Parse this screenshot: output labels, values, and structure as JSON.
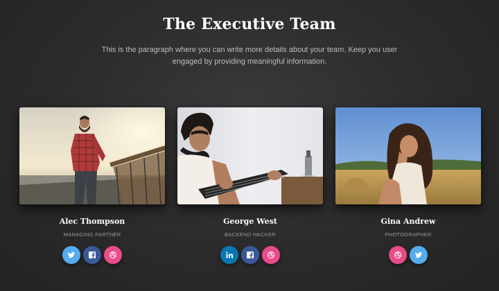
{
  "header": {
    "title": "The Executive Team",
    "description": "This is the paragraph where you can write more details about your team. Keep you user engaged by providing meaningful information."
  },
  "team": [
    {
      "name": "Alec Thompson",
      "role": "MANAGING PARTNER",
      "socials": [
        {
          "network": "twitter",
          "icon": "twitter-icon",
          "color": "#55acee"
        },
        {
          "network": "facebook",
          "icon": "facebook-icon",
          "color": "#3b5998"
        },
        {
          "network": "dribbble",
          "icon": "dribbble-icon",
          "color": "#ea4c89"
        }
      ]
    },
    {
      "name": "George West",
      "role": "BACKEND HACKER",
      "socials": [
        {
          "network": "linkedin",
          "icon": "linkedin-icon",
          "color": "#0976b4"
        },
        {
          "network": "facebook",
          "icon": "facebook-icon",
          "color": "#3b5998"
        },
        {
          "network": "dribbble",
          "icon": "dribbble-icon",
          "color": "#ea4c89"
        }
      ]
    },
    {
      "name": "Gina Andrew",
      "role": "PHOTOGRAPHER",
      "socials": [
        {
          "network": "dribbble",
          "icon": "dribbble-icon",
          "color": "#ea4c89"
        },
        {
          "network": "twitter",
          "icon": "twitter-icon",
          "color": "#55acee"
        }
      ]
    }
  ]
}
